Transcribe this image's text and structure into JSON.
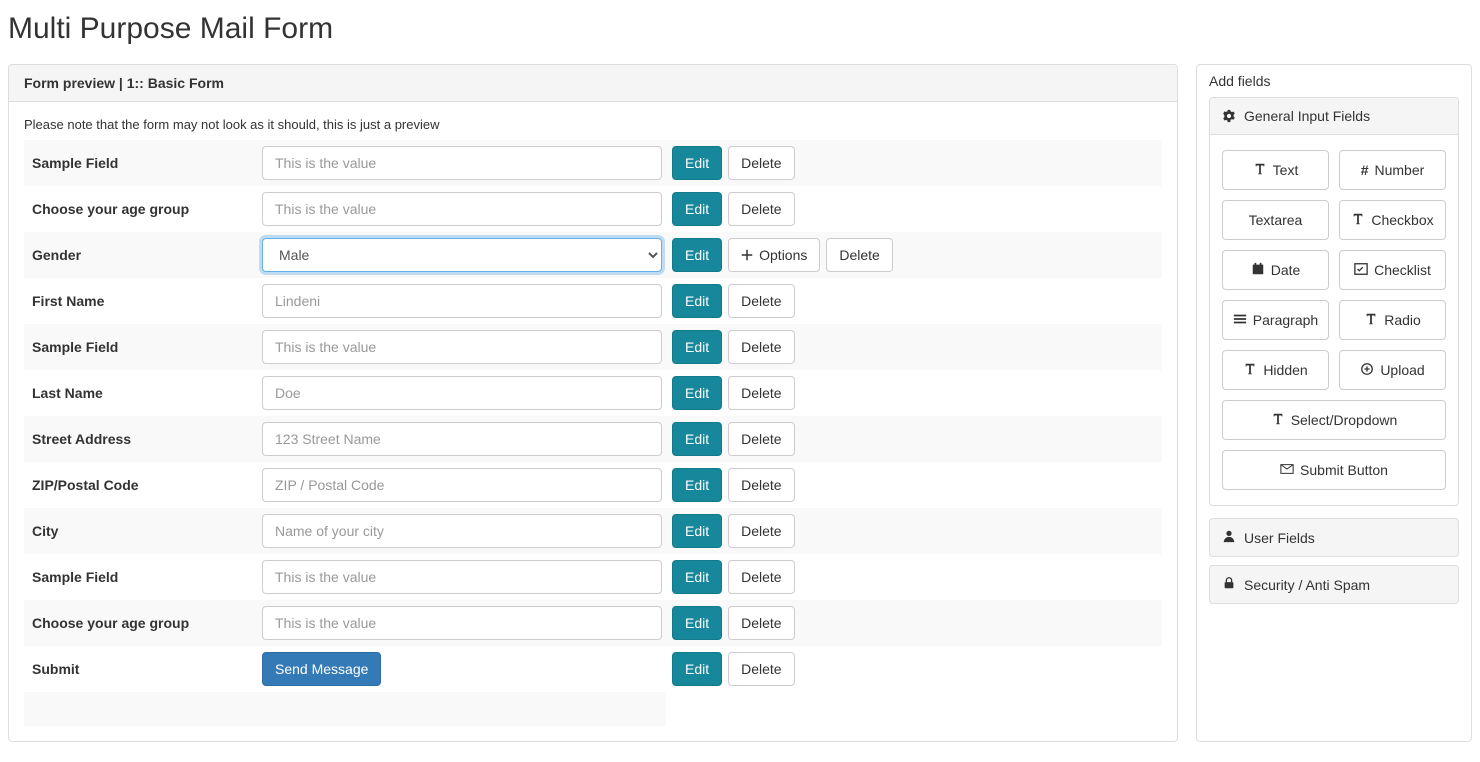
{
  "page_title": "Multi Purpose Mail Form",
  "left": {
    "heading": "Form preview | 1:: Basic Form",
    "note": "Please note that the form may not look as it should, this is just a preview",
    "edit_label": "Edit",
    "delete_label": "Delete",
    "options_label": "Options",
    "rows": [
      {
        "label": "Sample Field",
        "placeholder": "This is the value",
        "type": "text"
      },
      {
        "label": "Choose your age group",
        "placeholder": "This is the value",
        "type": "text"
      },
      {
        "label": "Gender",
        "type": "select",
        "selected": "Male",
        "has_options": true
      },
      {
        "label": "First Name",
        "placeholder": "Lindeni",
        "type": "text"
      },
      {
        "label": "Sample Field",
        "placeholder": "This is the value",
        "type": "text"
      },
      {
        "label": "Last Name",
        "placeholder": "Doe",
        "type": "text"
      },
      {
        "label": "Street Address",
        "placeholder": "123 Street Name",
        "type": "text"
      },
      {
        "label": "ZIP/Postal Code",
        "placeholder": "ZIP / Postal Code",
        "type": "text"
      },
      {
        "label": "City",
        "placeholder": "Name of your city",
        "type": "text"
      },
      {
        "label": "Sample Field",
        "placeholder": "This is the value",
        "type": "text"
      },
      {
        "label": "Choose your age group",
        "placeholder": "This is the value",
        "type": "text"
      },
      {
        "label": "Submit",
        "type": "submit",
        "button_text": "Send Message"
      }
    ]
  },
  "right": {
    "heading": "Add fields",
    "general_heading": "General Input Fields",
    "types": [
      {
        "icon": "text",
        "label": "Text"
      },
      {
        "icon": "hash",
        "label": "Number",
        "prefix": "# "
      },
      {
        "icon": "none",
        "label": "Textarea"
      },
      {
        "icon": "text",
        "label": "Checkbox"
      },
      {
        "icon": "calendar",
        "label": "Date"
      },
      {
        "icon": "list-check",
        "label": "Checklist"
      },
      {
        "icon": "paragraph",
        "label": "Paragraph"
      },
      {
        "icon": "text",
        "label": "Radio"
      },
      {
        "icon": "text",
        "label": "Hidden"
      },
      {
        "icon": "upload",
        "label": "Upload"
      },
      {
        "icon": "text",
        "label": "Select/Dropdown",
        "full": true
      },
      {
        "icon": "envelope",
        "label": "Submit Button",
        "full": true
      }
    ],
    "collapsed": [
      {
        "icon": "user",
        "label": "User Fields"
      },
      {
        "icon": "lock",
        "label": "Security / Anti Spam"
      }
    ]
  }
}
